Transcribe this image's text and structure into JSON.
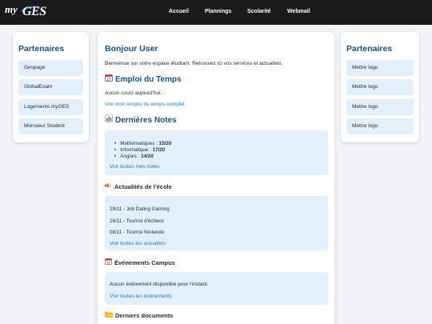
{
  "header": {
    "logo": {
      "my": "my",
      "ges": "GES"
    },
    "nav": [
      "Accueil",
      "Plannings",
      "Scolarité",
      "Webmail"
    ]
  },
  "left_panel": {
    "title": "Partenaires",
    "items": [
      "Gespage",
      "GlobalExam",
      "Logements myGES",
      "Monsieur Student"
    ]
  },
  "right_panel": {
    "title": "Partenaires",
    "items": [
      "Mettre logo",
      "Mettre logo",
      "Mettre logo",
      "Mettre logo"
    ]
  },
  "main": {
    "greeting": "Bonjour User",
    "welcome": "Bienvenue sur votre espace étudiant. Retrouvez ici vos services et actualités.",
    "schedule": {
      "icon": "calendar-icon",
      "title": "Emploi du Temps",
      "text": "Aucun cours aujourd'hui.",
      "link": "Voir mon emploi du temps complet"
    },
    "grades": {
      "icon": "bar-chart-icon",
      "title": "Dernières Notes",
      "items": [
        {
          "subject": "Mathématiques : ",
          "grade": "15/20"
        },
        {
          "subject": "Informatique : ",
          "grade": "17/20"
        },
        {
          "subject": "Anglais : ",
          "grade": "14/20"
        }
      ],
      "link": "Voir toutes mes notes"
    },
    "news": {
      "icon": "megaphone-icon",
      "title": "Actualités de l'école",
      "items": [
        "29/11 - Job Dating Gaming",
        "16/11 - Tournoi d'échecs",
        "08/11 - Tournoi Nintendo"
      ],
      "link": "Voir toutes les actualités"
    },
    "events": {
      "icon": "calendar-icon",
      "title": "Événements Campus",
      "text": "Aucun événement disponible pour l'instant.",
      "link": "Voir toutes les événements"
    },
    "documents": {
      "icon": "folder-icon",
      "title": "Derniers documents"
    }
  }
}
